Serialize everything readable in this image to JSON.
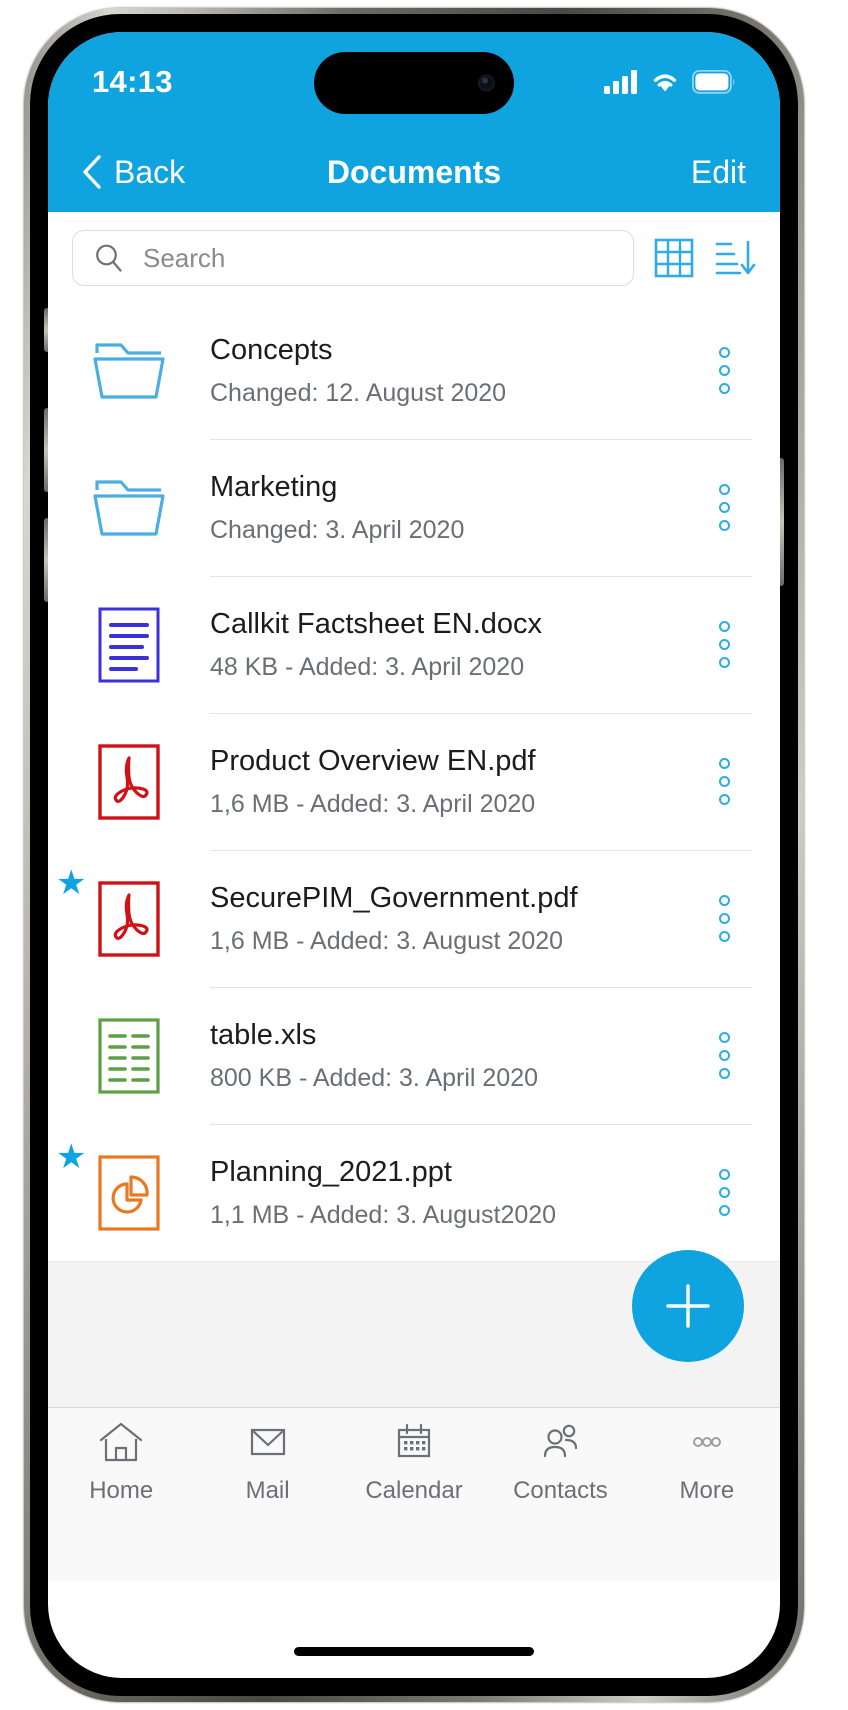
{
  "status_bar": {
    "time": "14:13",
    "icons": [
      "cellular-signal-icon",
      "wifi-icon",
      "battery-icon"
    ]
  },
  "nav_bar": {
    "back_label": "Back",
    "title": "Documents",
    "edit_label": "Edit",
    "back_icon": "chevron-left-icon"
  },
  "search": {
    "placeholder": "Search",
    "value": "",
    "search_icon": "search-icon",
    "grid_view_icon": "grid-view-icon",
    "sort_icon": "sort-descending-icon"
  },
  "files": [
    {
      "name": "Concepts",
      "meta": "Changed: 12. August 2020",
      "icon": "folder-icon",
      "type": "folder",
      "starred": false
    },
    {
      "name": "Marketing",
      "meta": "Changed: 3. April 2020",
      "icon": "folder-icon",
      "type": "folder",
      "starred": false
    },
    {
      "name": "Callkit Factsheet EN.docx",
      "meta": "48 KB - Added: 3. April 2020",
      "icon": "word-document-icon",
      "type": "docx",
      "starred": false
    },
    {
      "name": "Product Overview EN.pdf",
      "meta": "1,6 MB - Added: 3. April 2020",
      "icon": "pdf-document-icon",
      "type": "pdf",
      "starred": false
    },
    {
      "name": "SecurePIM_Government.pdf",
      "meta": "1,6 MB - Added: 3. August 2020",
      "icon": "pdf-document-icon",
      "type": "pdf",
      "starred": true
    },
    {
      "name": "table.xls",
      "meta": "800 KB - Added: 3. April 2020",
      "icon": "excel-document-icon",
      "type": "xls",
      "starred": false
    },
    {
      "name": "Planning_2021.ppt",
      "meta": "1,1 MB - Added: 3. August2020",
      "icon": "powerpoint-document-icon",
      "type": "ppt",
      "starred": true
    }
  ],
  "row_menu_icon": "more-options-vertical-icon",
  "star_glyph": "★",
  "fab": {
    "icon": "plus-icon",
    "label": "Add"
  },
  "tab_bar": {
    "items": [
      {
        "label": "Home",
        "icon": "home-icon"
      },
      {
        "label": "Mail",
        "icon": "mail-icon"
      },
      {
        "label": "Calendar",
        "icon": "calendar-icon"
      },
      {
        "label": "Contacts",
        "icon": "contacts-icon"
      },
      {
        "label": "More",
        "icon": "more-icon"
      }
    ]
  },
  "colors": {
    "accent": "#0FA3E0",
    "folder": "#4BAEE3",
    "pdf": "#D01217",
    "word": "#3A31D8",
    "excel": "#5E9E47",
    "powerpoint": "#E8791E",
    "tab_inactive": "#6B7076"
  }
}
